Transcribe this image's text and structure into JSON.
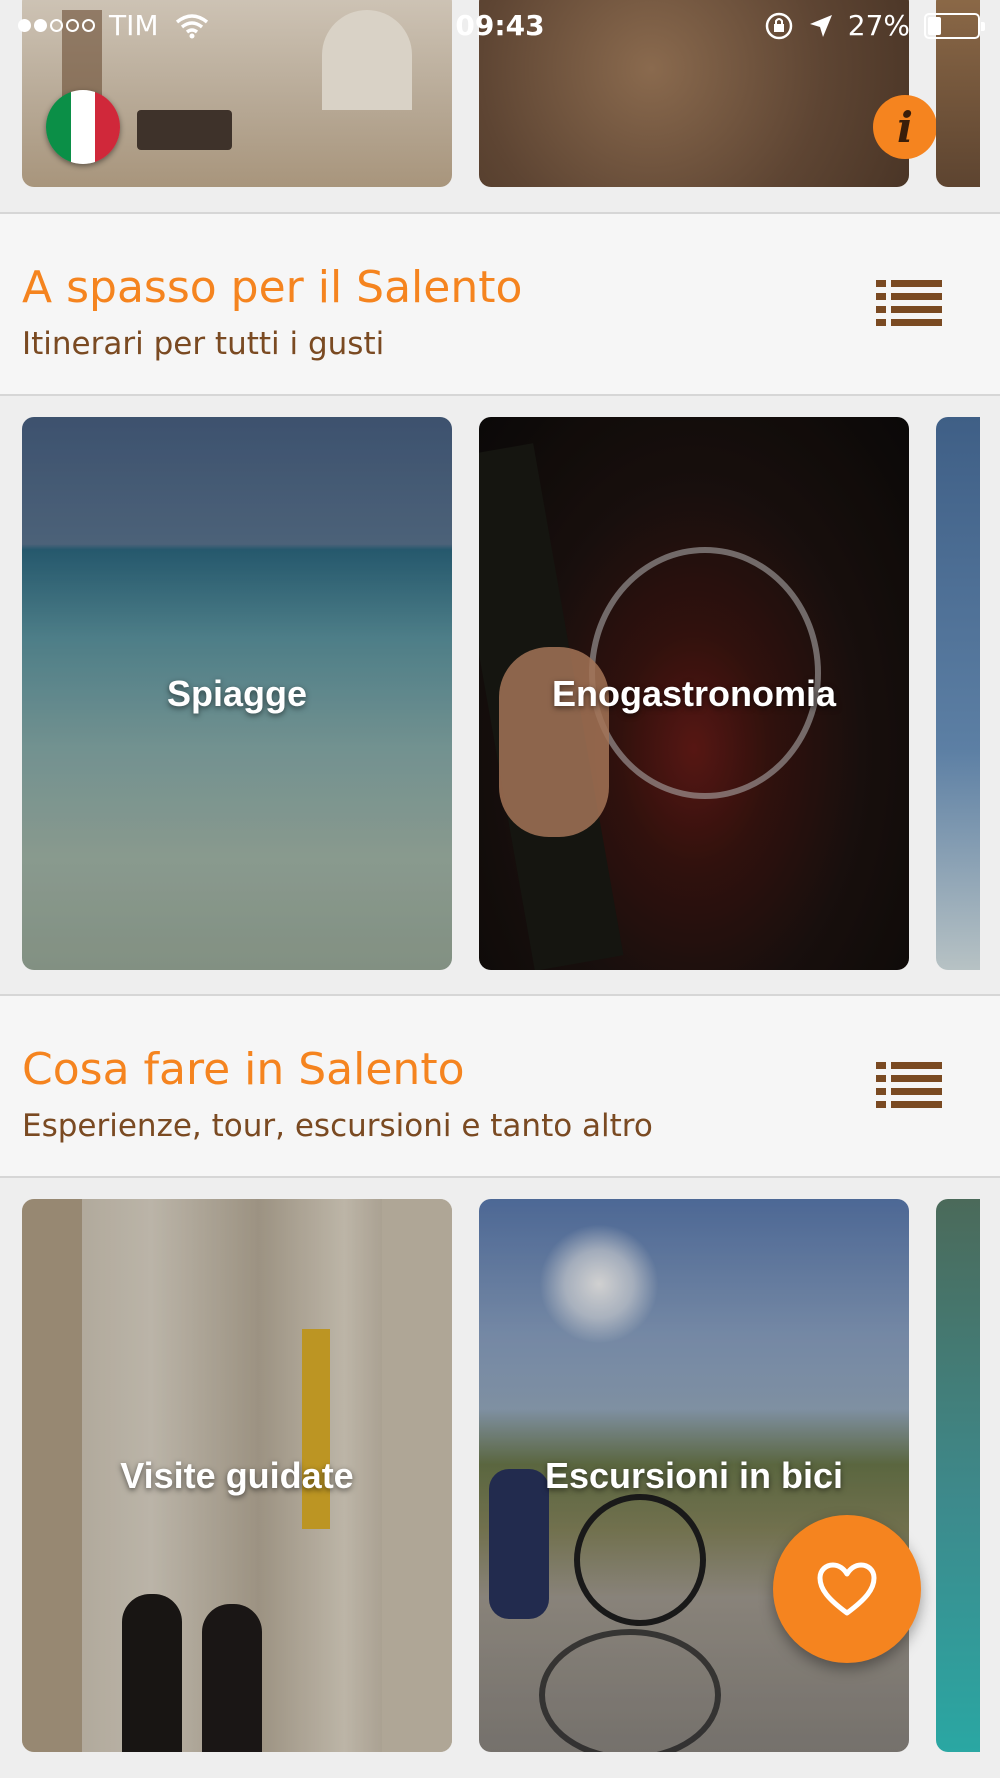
{
  "status_bar": {
    "carrier": "TIM",
    "time": "09:43",
    "battery": "27%",
    "battery_level": 0.27,
    "signal_bars_filled": 2,
    "signal_bars_total": 5
  },
  "colors": {
    "accent": "#f5841f",
    "brown": "#7a4a22",
    "background": "#eeeeee"
  },
  "top_row": {
    "icons": [
      "italian-flag-icon",
      "info-icon"
    ]
  },
  "sections": [
    {
      "title": "A spasso per il Salento",
      "subtitle": "Itinerari per tutti i gusti",
      "cards": [
        {
          "label": "Spiagge"
        },
        {
          "label": "Enogastronomia"
        }
      ]
    },
    {
      "title": "Cosa fare in Salento",
      "subtitle": "Esperienze, tour, escursioni e tanto altro",
      "cards": [
        {
          "label": "Visite guidate"
        },
        {
          "label": "Escursioni in bici"
        }
      ]
    }
  ],
  "fab": {
    "icon": "heart-icon"
  }
}
